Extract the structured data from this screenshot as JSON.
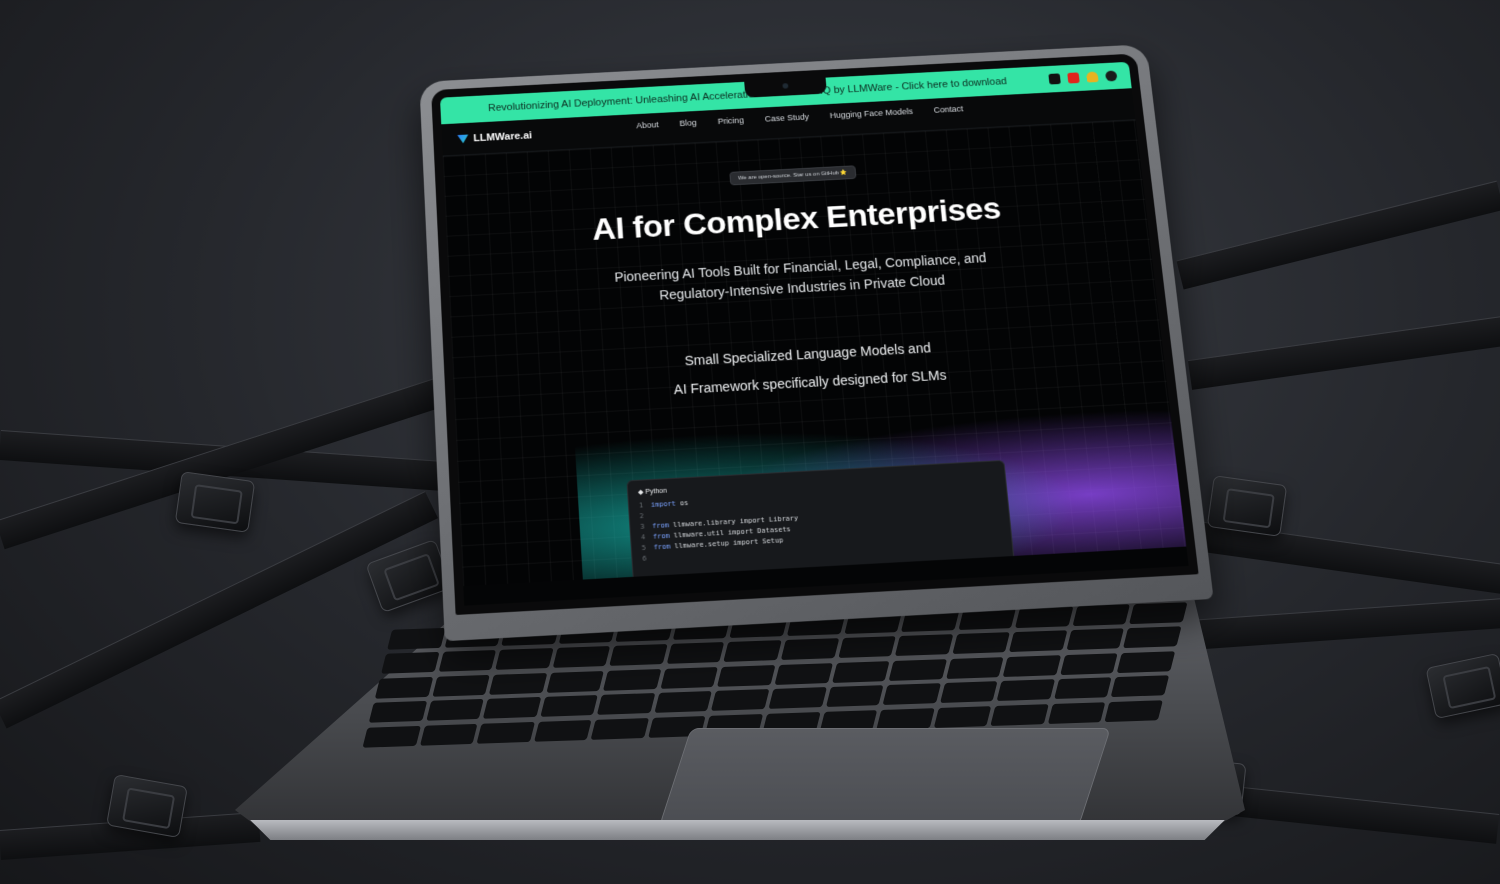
{
  "banner": {
    "text": "Revolutionizing AI Deployment: Unleashing AI Acceleration with Model HQ by LLMWare - Click here to download",
    "color": "#34e4a6",
    "icons": [
      "discord-icon",
      "youtube-icon",
      "bell-icon",
      "github-icon"
    ]
  },
  "nav": {
    "logo": "LLMWare.ai",
    "links": [
      "About",
      "Blog",
      "Pricing",
      "Case Study",
      "Hugging Face Models",
      "Contact"
    ]
  },
  "hero": {
    "pill": "We are open-source. Star us on GitHub ⭐",
    "title": "AI for Complex Enterprises",
    "subtitle_line1": "Pioneering AI Tools Built for Financial, Legal, Compliance, and",
    "subtitle_line2": "Regulatory-Intensive Industries in Private Cloud",
    "tagline_line1": "Small Specialized Language Models and",
    "tagline_line2": "AI Framework specifically designed for SLMs"
  },
  "code": {
    "tab": "Python",
    "lines": [
      {
        "n": "1",
        "kw": "import",
        "rest": " os"
      },
      {
        "n": "2",
        "kw": "",
        "rest": ""
      },
      {
        "n": "3",
        "kw": "from",
        "rest": " llmware.library import Library"
      },
      {
        "n": "4",
        "kw": "from",
        "rest": " llmware.util import Datasets"
      },
      {
        "n": "5",
        "kw": "from",
        "rest": " llmware.setup import Setup"
      },
      {
        "n": "6",
        "kw": "",
        "rest": ""
      }
    ]
  }
}
